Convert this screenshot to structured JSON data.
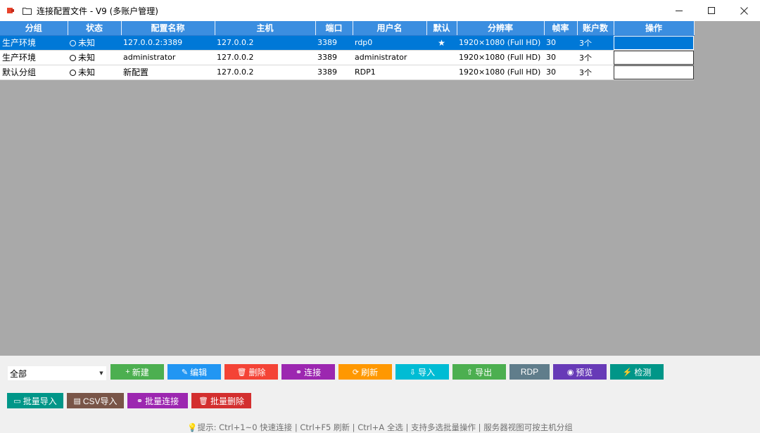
{
  "window": {
    "title": "连接配置文件 - V9 (多账户管理)",
    "controls": {
      "minimize": "—",
      "maximize": "□",
      "close": "✕"
    }
  },
  "table": {
    "columns": [
      "分组",
      "状态",
      "配置名称",
      "主机",
      "端口",
      "用户名",
      "默认",
      "分辨率",
      "帧率",
      "账户数",
      "操作"
    ],
    "rows": [
      {
        "group": "生产环境",
        "status": "未知",
        "name": "127.0.0.2:3389",
        "host": "127.0.0.2",
        "port": "3389",
        "user": "rdp0",
        "default": "★",
        "resolution": "1920×1080 (Full HD)",
        "fps": "30",
        "accounts": "3个",
        "selected": true
      },
      {
        "group": "生产环境",
        "status": "未知",
        "name": "administrator",
        "host": "127.0.0.2",
        "port": "3389",
        "user": "administrator",
        "default": "",
        "resolution": "1920×1080 (Full HD)",
        "fps": "30",
        "accounts": "3个",
        "selected": false
      },
      {
        "group": "默认分组",
        "status": "未知",
        "name": "新配置",
        "host": "127.0.0.2",
        "port": "3389",
        "user": "RDP1",
        "default": "",
        "resolution": "1920×1080 (Full HD)",
        "fps": "30",
        "accounts": "3个",
        "selected": false
      }
    ]
  },
  "filter": {
    "group_value": "全部"
  },
  "toolbar": {
    "new": {
      "label": "新建",
      "icon": "+",
      "color": "#4caf50"
    },
    "edit": {
      "label": "编辑",
      "icon": "✎",
      "color": "#2196f3"
    },
    "delete": {
      "label": "删除",
      "icon": "🗑",
      "color": "#f44336"
    },
    "connect": {
      "label": "连接",
      "icon": "⚭",
      "color": "#9c27b0"
    },
    "refresh": {
      "label": "刷新",
      "icon": "⟳",
      "color": "#ff9800"
    },
    "import": {
      "label": "导入",
      "icon": "⇩",
      "color": "#00bcd4"
    },
    "export": {
      "label": "导出",
      "icon": "⇧",
      "color": "#4caf50"
    },
    "rdp": {
      "label": "RDP",
      "color": "#607d8b"
    },
    "preview": {
      "label": "预览",
      "icon": "◉",
      "color": "#673ab7"
    },
    "detect": {
      "label": "检测",
      "icon": "⚡",
      "color": "#009688"
    },
    "batch_import": {
      "label": "批量导入",
      "icon": "▭",
      "color": "#009688"
    },
    "csv_import": {
      "label": "CSV导入",
      "icon": "▤",
      "color": "#795548"
    },
    "batch_connect": {
      "label": "批量连接",
      "icon": "⚭",
      "color": "#9c27b0"
    },
    "batch_delete": {
      "label": "批量删除",
      "icon": "🗑",
      "color": "#d32f2f"
    }
  },
  "hint": "提示: Ctrl+1~0 快速连接 | Ctrl+F5 刷新 | Ctrl+A 全选 | 支持多选批量操作 | 服务器视图可按主机分组"
}
